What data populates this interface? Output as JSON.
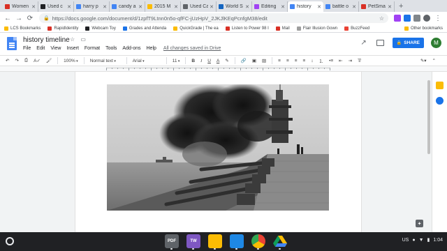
{
  "browser": {
    "tabs": [
      {
        "title": "Women",
        "color": "#d93025",
        "active": false
      },
      {
        "title": "Used c",
        "color": "#202124",
        "active": false
      },
      {
        "title": "harry p",
        "color": "#4285f4",
        "active": false
      },
      {
        "title": "candy a",
        "color": "#4285f4",
        "active": false
      },
      {
        "title": "2015 M",
        "color": "#fbbc04",
        "active": false
      },
      {
        "title": "Used Ca",
        "color": "#5f6368",
        "active": false
      },
      {
        "title": "World S",
        "color": "#1565c0",
        "active": false
      },
      {
        "title": "Editing",
        "color": "#a142f4",
        "active": false
      },
      {
        "title": "history",
        "color": "#4285f4",
        "active": true
      },
      {
        "title": "battle o",
        "color": "#4285f4",
        "active": false
      },
      {
        "title": "PetSma",
        "color": "#d93025",
        "active": false
      }
    ],
    "new_tab": "+",
    "url": "https://docs.google.com/document/d/1zpfT9Ltnn0n5o-qfFC-jUzHpV_2JKJlKEqPcnfgM38/edit",
    "bookmarks": [
      {
        "label": "LCS Bookmarks",
        "color": "#fbbc04"
      },
      {
        "label": "RapidIdentity",
        "color": "#d93025"
      },
      {
        "label": "Webcam Toy",
        "color": "#202124"
      },
      {
        "label": "Grades and Attenda",
        "color": "#1a73e8"
      },
      {
        "label": "QuickGrade | The ea",
        "color": "#fbbc04"
      },
      {
        "label": "Listen to Power 98 I",
        "color": "#d93025"
      },
      {
        "label": "Mail",
        "color": "#d93025"
      },
      {
        "label": "Flair Illusion Gown",
        "color": "#9e9e9e"
      },
      {
        "label": "BuzzFeed",
        "color": "#ea4335"
      }
    ],
    "other_bookmarks": "Other bookmarks"
  },
  "docs": {
    "title": "history timeline",
    "menu": [
      "File",
      "Edit",
      "View",
      "Insert",
      "Format",
      "Tools",
      "Add-ons",
      "Help"
    ],
    "saved_status": "All changes saved in Drive",
    "share_label": "SHARE",
    "avatar_letter": "M",
    "toolbar": {
      "zoom": "100%",
      "style": "Normal text",
      "font": "Arial",
      "size": "11",
      "bold": "B",
      "italic": "I",
      "underline": "U",
      "text_color": "A"
    }
  },
  "shelf": {
    "apps": [
      {
        "label": "PDF",
        "color": "#5f6368"
      },
      {
        "label": "TW",
        "color": "#7e57c2"
      },
      {
        "label": "",
        "color": "#fbbc04"
      },
      {
        "label": "",
        "color": "#1e88e5"
      },
      {
        "label": "",
        "color": "#ffffff"
      },
      {
        "label": "",
        "color": "#0f9d58"
      }
    ],
    "locale": "US",
    "time": "1:04"
  }
}
